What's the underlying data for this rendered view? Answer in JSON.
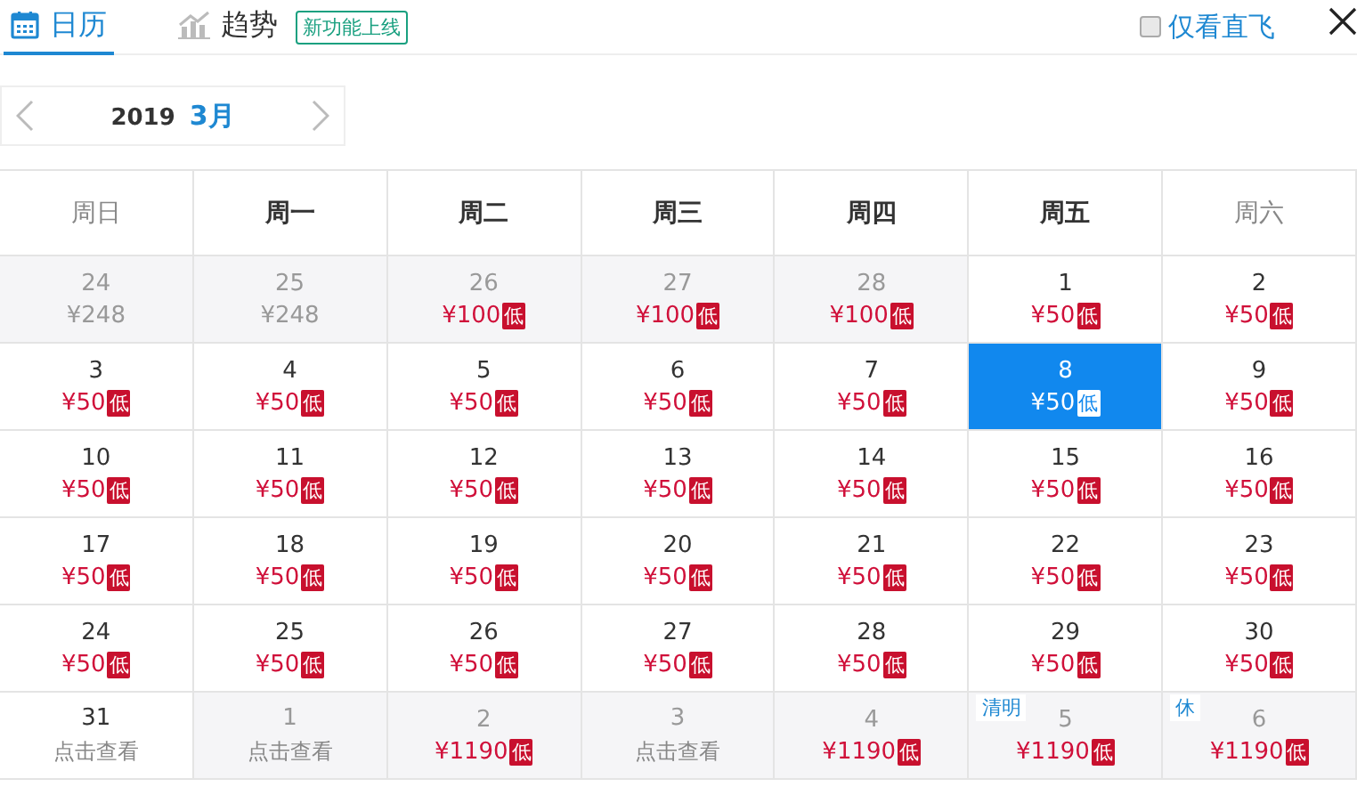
{
  "tabs": [
    {
      "label": "日历",
      "kind": "calendar",
      "selected": true
    },
    {
      "label": "趋势",
      "kind": "chart",
      "selected": false
    }
  ],
  "new_badge": "新功能上线",
  "direct_only": {
    "label": "仅看直飞",
    "checked": false
  },
  "month_nav": {
    "year": "2019",
    "month": "3月"
  },
  "weekdays": [
    {
      "label": "周日",
      "weekend": true
    },
    {
      "label": "周一",
      "weekend": false
    },
    {
      "label": "周二",
      "weekend": false
    },
    {
      "label": "周三",
      "weekend": false
    },
    {
      "label": "周四",
      "weekend": false
    },
    {
      "label": "周五",
      "weekend": false
    },
    {
      "label": "周六",
      "weekend": true
    }
  ],
  "days": [
    {
      "day": "24",
      "kind": "price",
      "text": "¥248",
      "outside": true,
      "selected": false
    },
    {
      "day": "25",
      "kind": "price",
      "text": "¥248",
      "outside": true,
      "selected": false
    },
    {
      "day": "26",
      "kind": "price",
      "text": "¥100",
      "badge": "低",
      "outside": true,
      "selected": false
    },
    {
      "day": "27",
      "kind": "price",
      "text": "¥100",
      "badge": "低",
      "outside": true,
      "selected": false
    },
    {
      "day": "28",
      "kind": "price",
      "text": "¥100",
      "badge": "低",
      "outside": true,
      "selected": false
    },
    {
      "day": "1",
      "kind": "price",
      "text": "¥50",
      "badge": "低",
      "outside": false,
      "selected": false
    },
    {
      "day": "2",
      "kind": "price",
      "text": "¥50",
      "badge": "低",
      "outside": false,
      "selected": false
    },
    {
      "day": "3",
      "kind": "price",
      "text": "¥50",
      "badge": "低",
      "outside": false,
      "selected": false
    },
    {
      "day": "4",
      "kind": "price",
      "text": "¥50",
      "badge": "低",
      "outside": false,
      "selected": false
    },
    {
      "day": "5",
      "kind": "price",
      "text": "¥50",
      "badge": "低",
      "outside": false,
      "selected": false
    },
    {
      "day": "6",
      "kind": "price",
      "text": "¥50",
      "badge": "低",
      "outside": false,
      "selected": false
    },
    {
      "day": "7",
      "kind": "price",
      "text": "¥50",
      "badge": "低",
      "outside": false,
      "selected": false
    },
    {
      "day": "8",
      "kind": "price",
      "text": "¥50",
      "badge": "低",
      "outside": false,
      "selected": true
    },
    {
      "day": "9",
      "kind": "price",
      "text": "¥50",
      "badge": "低",
      "outside": false,
      "selected": false
    },
    {
      "day": "10",
      "kind": "price",
      "text": "¥50",
      "badge": "低",
      "outside": false,
      "selected": false
    },
    {
      "day": "11",
      "kind": "price",
      "text": "¥50",
      "badge": "低",
      "outside": false,
      "selected": false
    },
    {
      "day": "12",
      "kind": "price",
      "text": "¥50",
      "badge": "低",
      "outside": false,
      "selected": false
    },
    {
      "day": "13",
      "kind": "price",
      "text": "¥50",
      "badge": "低",
      "outside": false,
      "selected": false
    },
    {
      "day": "14",
      "kind": "price",
      "text": "¥50",
      "badge": "低",
      "outside": false,
      "selected": false
    },
    {
      "day": "15",
      "kind": "price",
      "text": "¥50",
      "badge": "低",
      "outside": false,
      "selected": false
    },
    {
      "day": "16",
      "kind": "price",
      "text": "¥50",
      "badge": "低",
      "outside": false,
      "selected": false
    },
    {
      "day": "17",
      "kind": "price",
      "text": "¥50",
      "badge": "低",
      "outside": false,
      "selected": false
    },
    {
      "day": "18",
      "kind": "price",
      "text": "¥50",
      "badge": "低",
      "outside": false,
      "selected": false
    },
    {
      "day": "19",
      "kind": "price",
      "text": "¥50",
      "badge": "低",
      "outside": false,
      "selected": false
    },
    {
      "day": "20",
      "kind": "price",
      "text": "¥50",
      "badge": "低",
      "outside": false,
      "selected": false
    },
    {
      "day": "21",
      "kind": "price",
      "text": "¥50",
      "badge": "低",
      "outside": false,
      "selected": false
    },
    {
      "day": "22",
      "kind": "price",
      "text": "¥50",
      "badge": "低",
      "outside": false,
      "selected": false
    },
    {
      "day": "23",
      "kind": "price",
      "text": "¥50",
      "badge": "低",
      "outside": false,
      "selected": false
    },
    {
      "day": "24",
      "kind": "price",
      "text": "¥50",
      "badge": "低",
      "outside": false,
      "selected": false
    },
    {
      "day": "25",
      "kind": "price",
      "text": "¥50",
      "badge": "低",
      "outside": false,
      "selected": false
    },
    {
      "day": "26",
      "kind": "price",
      "text": "¥50",
      "badge": "低",
      "outside": false,
      "selected": false
    },
    {
      "day": "27",
      "kind": "price",
      "text": "¥50",
      "badge": "低",
      "outside": false,
      "selected": false
    },
    {
      "day": "28",
      "kind": "price",
      "text": "¥50",
      "badge": "低",
      "outside": false,
      "selected": false
    },
    {
      "day": "29",
      "kind": "price",
      "text": "¥50",
      "badge": "低",
      "outside": false,
      "selected": false
    },
    {
      "day": "30",
      "kind": "price",
      "text": "¥50",
      "badge": "低",
      "outside": false,
      "selected": false
    },
    {
      "day": "31",
      "kind": "link",
      "text": "点击查看",
      "outside": false,
      "selected": false
    },
    {
      "day": "1",
      "kind": "link",
      "text": "点击查看",
      "outside": true,
      "selected": false
    },
    {
      "day": "2",
      "kind": "price",
      "text": "¥1190",
      "badge": "低",
      "outside": true,
      "selected": false
    },
    {
      "day": "3",
      "kind": "link",
      "text": "点击查看",
      "outside": true,
      "selected": false
    },
    {
      "day": "4",
      "kind": "price",
      "text": "¥1190",
      "badge": "低",
      "outside": true,
      "selected": false
    },
    {
      "day": "5",
      "kind": "price",
      "text": "¥1190",
      "badge": "低",
      "tag": "清明",
      "outside": true,
      "selected": false
    },
    {
      "day": "6",
      "kind": "price",
      "text": "¥1190",
      "badge": "低",
      "tag": "休",
      "outside": true,
      "selected": false
    }
  ]
}
